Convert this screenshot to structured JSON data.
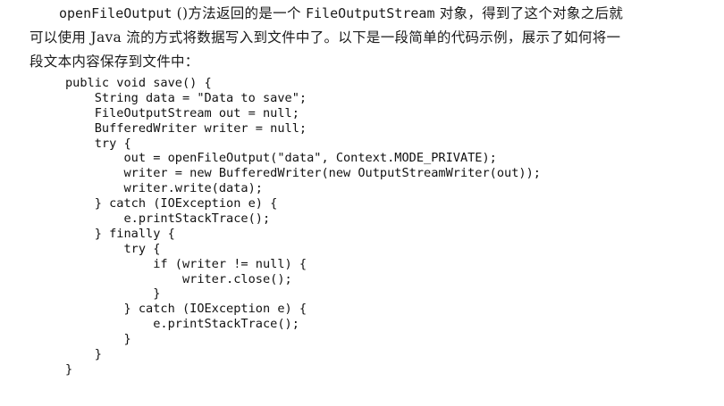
{
  "paragraph": {
    "line1": {
      "code_term_1": "openFileOutput",
      "text_1": " ()方法返回的是一个 ",
      "code_term_2": "FileOutputStream",
      "text_2": " 对象，得到了这个对象之后就"
    },
    "line2": "可以使用 Java 流的方式将数据写入到文件中了。以下是一段简单的代码示例，展示了如何将一",
    "line3": "段文本内容保存到文件中："
  },
  "code": {
    "lines": [
      "public void save() {",
      "    String data = \"Data to save\";",
      "    FileOutputStream out = null;",
      "    BufferedWriter writer = null;",
      "    try {",
      "        out = openFileOutput(\"data\", Context.MODE_PRIVATE);",
      "        writer = new BufferedWriter(new OutputStreamWriter(out));",
      "        writer.write(data);",
      "    } catch (IOException e) {",
      "        e.printStackTrace();",
      "    } finally {",
      "        try {",
      "            if (writer != null) {",
      "                writer.close();",
      "            }",
      "        } catch (IOException e) {",
      "            e.printStackTrace();",
      "        }",
      "    }",
      "}"
    ]
  }
}
